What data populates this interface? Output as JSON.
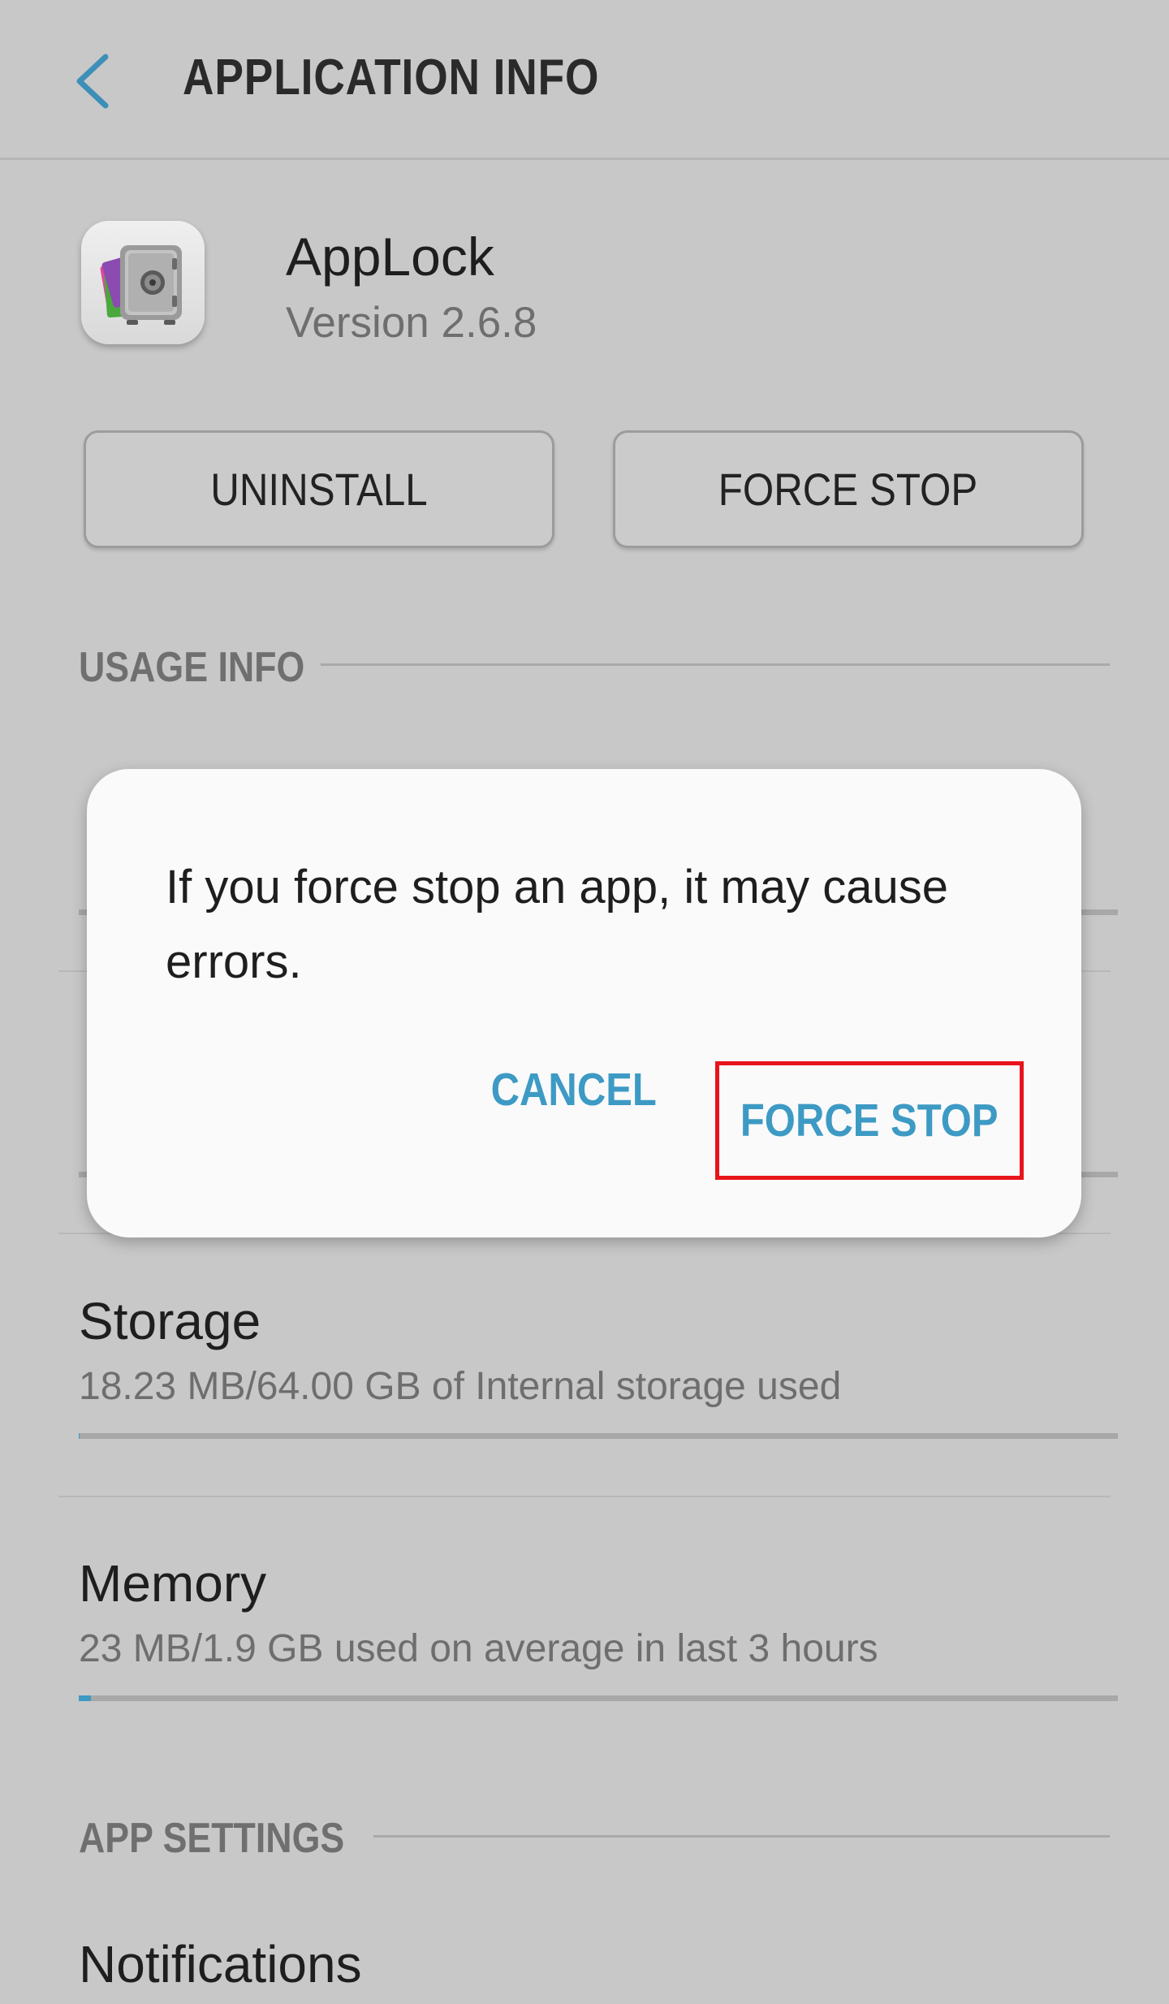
{
  "header": {
    "title": "APPLICATION INFO"
  },
  "app": {
    "name": "AppLock",
    "version": "Version 2.6.8",
    "icon": "applock-safe-icon"
  },
  "actions": {
    "uninstall_label": "UNINSTALL",
    "force_stop_label": "FORCE STOP"
  },
  "usage_info": {
    "section_label": "USAGE INFO",
    "storage": {
      "title": "Storage",
      "subtitle": "18.23 MB/64.00 GB of Internal storage used",
      "fraction": 0.0003
    },
    "memory": {
      "title": "Memory",
      "subtitle": "23 MB/1.9 GB used on average in last 3 hours",
      "fraction": 0.012
    }
  },
  "app_settings": {
    "section_label": "APP SETTINGS",
    "notifications_title": "Notifications"
  },
  "dialog": {
    "message": "If you force stop an app, it may cause errors.",
    "cancel_label": "CANCEL",
    "confirm_label": "FORCE STOP"
  },
  "colors": {
    "accent": "#3d9ac4",
    "highlight": "#e8141b",
    "background": "#c8c8c8",
    "dialog_bg": "#fafafa"
  }
}
